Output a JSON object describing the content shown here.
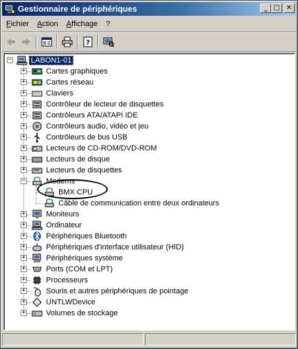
{
  "window": {
    "title": "Gestionnaire de périphériques"
  },
  "window_buttons": {
    "minimize": "_",
    "maximize": "□",
    "close": "✕"
  },
  "menu": [
    "Fichier",
    "Action",
    "Affichage",
    "?"
  ],
  "toolbar": [
    "back-icon",
    "forward-icon",
    "properties-icon",
    "print-icon",
    "help-icon",
    "scan-hardware-icon"
  ],
  "tree": {
    "root": {
      "label": "LABON1-01",
      "expander": "−",
      "icon": "computer-icon"
    },
    "items": [
      {
        "label": "Cartes graphiques",
        "expander": "+",
        "icon": "display-adapter-icon"
      },
      {
        "label": "Cartes réseau",
        "expander": "+",
        "icon": "network-adapter-icon"
      },
      {
        "label": "Claviers",
        "expander": "+",
        "icon": "keyboard-icon"
      },
      {
        "label": "Contrôleur de lecteur de disquettes",
        "expander": "+",
        "icon": "floppy-controller-icon"
      },
      {
        "label": "Contrôleurs ATA/ATAPI IDE",
        "expander": "+",
        "icon": "ide-controller-icon"
      },
      {
        "label": "Contrôleurs audio, vidéo et jeu",
        "expander": "+",
        "icon": "audio-icon"
      },
      {
        "label": "Contrôleurs de bus USB",
        "expander": "+",
        "icon": "usb-icon"
      },
      {
        "label": "Lecteurs de CD-ROM/DVD-ROM",
        "expander": "+",
        "icon": "cdrom-icon"
      },
      {
        "label": "Lecteurs de disque",
        "expander": "+",
        "icon": "disk-drive-icon"
      },
      {
        "label": "Lecteurs de disquettes",
        "expander": "+",
        "icon": "floppy-drive-icon"
      },
      {
        "label": "Modems",
        "expander": "−",
        "icon": "modem-icon"
      },
      {
        "label": "BMX CPU",
        "icon": "modem-icon",
        "child": true
      },
      {
        "label": "Câble de communication entre deux ordinateurs",
        "icon": "modem-icon",
        "child": true
      },
      {
        "label": "Moniteurs",
        "expander": "+",
        "icon": "monitor-icon"
      },
      {
        "label": "Ordinateur",
        "expander": "+",
        "icon": "computer-icon"
      },
      {
        "label": "Périphériques Bluetooth",
        "expander": "+",
        "icon": "bluetooth-icon"
      },
      {
        "label": "Périphériques d'interface utilisateur (HID)",
        "expander": "+",
        "icon": "hid-icon"
      },
      {
        "label": "Périphériques système",
        "expander": "+",
        "icon": "system-device-icon"
      },
      {
        "label": "Ports (COM et LPT)",
        "expander": "+",
        "icon": "port-icon"
      },
      {
        "label": "Processeurs",
        "expander": "+",
        "icon": "processor-icon"
      },
      {
        "label": "Souris et autres périphériques de pointage",
        "expander": "+",
        "icon": "mouse-icon"
      },
      {
        "label": "UNTLWDevice",
        "expander": "+",
        "icon": "untlw-device-icon"
      },
      {
        "label": "Volumes de stockage",
        "expander": "+",
        "icon": "storage-volume-icon"
      }
    ]
  }
}
